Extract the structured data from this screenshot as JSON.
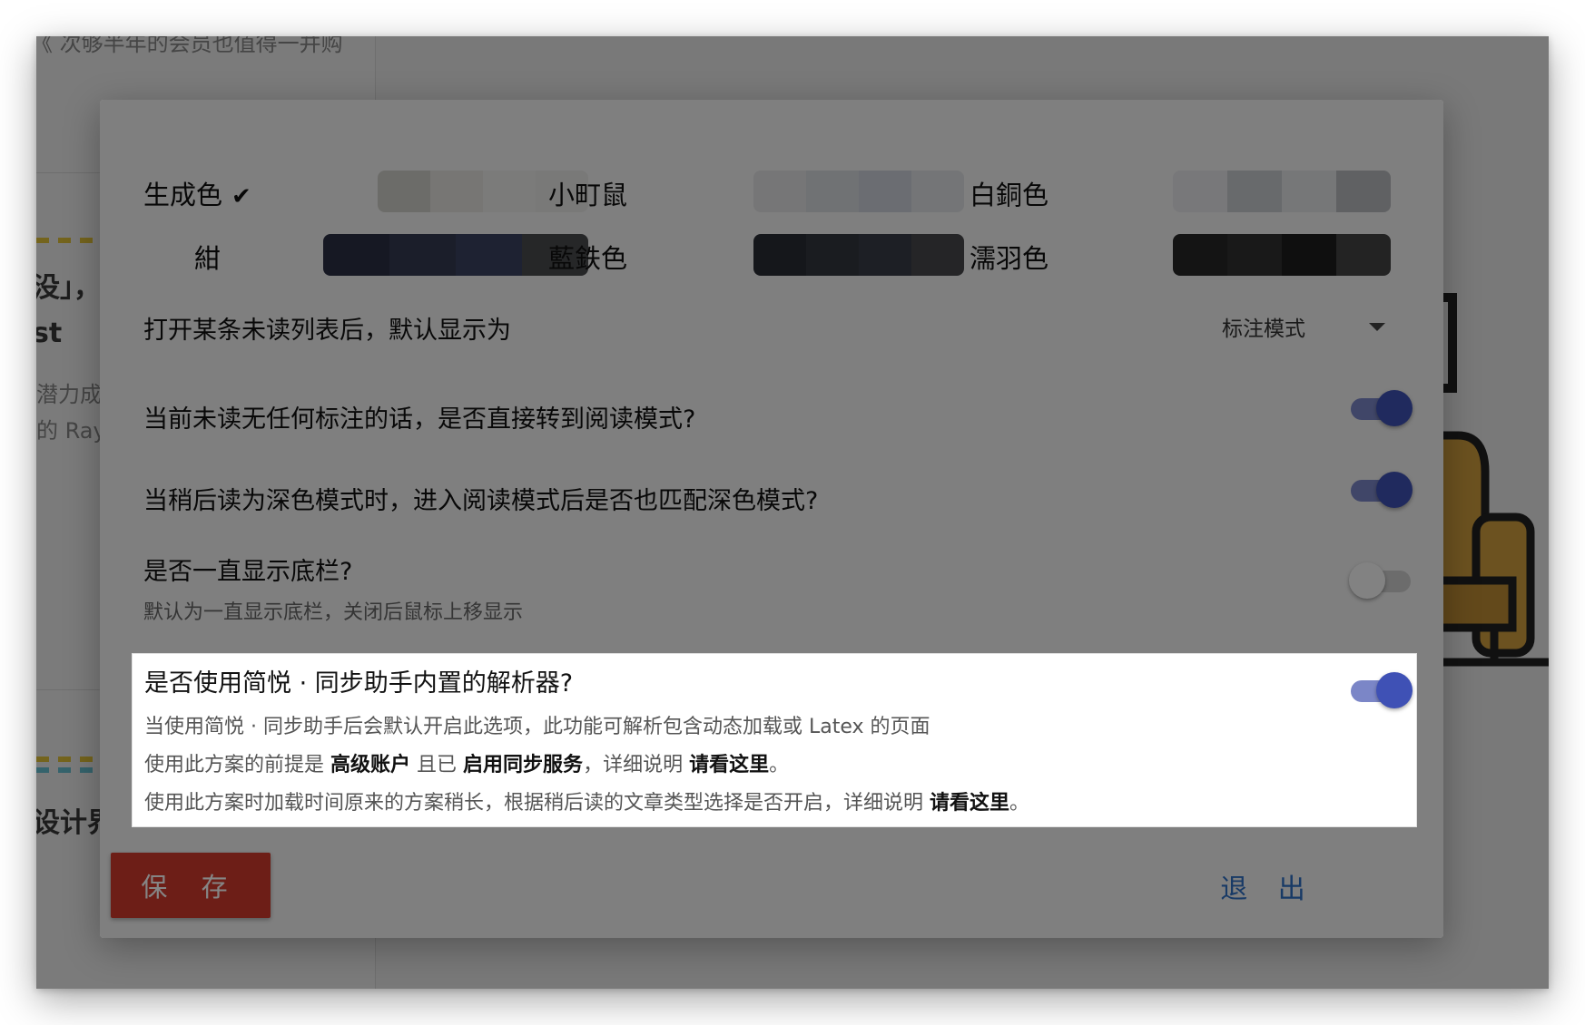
{
  "background": {
    "top_text": "《 次够半年的会员也值得一并购",
    "text_1": "没」，",
    "text_2": "st",
    "text_3": "潜力成",
    "text_4": "的 Ray",
    "text_5": "设计界"
  },
  "colors": {
    "accent": "#3f51b5",
    "save_red": "#d23a2d",
    "link_blue": "#2f6fc4"
  },
  "themes": [
    {
      "label": "生成色",
      "selected": true,
      "check_icon": "checkmark-icon",
      "swatch": [
        "#d0cfc9",
        "#e4e3df",
        "#ececea",
        "#e8e8e6"
      ]
    },
    {
      "label": "小町鼠",
      "selected": false,
      "swatch": [
        "#e2e3e4",
        "#d7dadf",
        "#cdd2da",
        "#dfe1e4"
      ]
    },
    {
      "label": "白銅色",
      "selected": false,
      "swatch": [
        "#e6e7ea",
        "#c8cbcf",
        "#e3e4e7",
        "#b9bbbe"
      ]
    },
    {
      "label": "紺",
      "selected": false,
      "swatch": [
        "#2b2f43",
        "#343a51",
        "#3b4260",
        "#4a4b4e"
      ]
    },
    {
      "label": "藍鉄色",
      "selected": false,
      "swatch": [
        "#2a2d35",
        "#33363f",
        "#383c47",
        "#47484c"
      ]
    },
    {
      "label": "濡羽色",
      "selected": false,
      "swatch": [
        "#282828",
        "#303030",
        "#1e1e1e",
        "#434343"
      ]
    }
  ],
  "settings": {
    "default_view_label": "打开某条未读列表后，默认显示为",
    "default_view_value": "标注模式",
    "auto_read_mode_label": "当前未读无任何标注的话，是否直接转到阅读模式?",
    "auto_read_mode_on": true,
    "dark_match_label": "当稍后读为深色模式时，进入阅读模式后是否也匹配深色模式?",
    "dark_match_on": true,
    "show_footer_label": "是否一直显示底栏?",
    "show_footer_desc": "默认为一直显示底栏，关闭后鼠标上移显示",
    "show_footer_on": false,
    "parser_label": "是否使用简悦 · 同步助手内置的解析器?",
    "parser_on": true,
    "parser_desc_1": "当使用简悦 · 同步助手后会默认开启此选项，此功能可解析包含动态加载或 Latex 的页面",
    "parser_desc_2_a": "使用此方案的前提是",
    "parser_desc_2_b": "高级账户",
    "parser_desc_2_c": "且已",
    "parser_desc_2_d": "启用同步服务",
    "parser_desc_2_e": "，详细说明",
    "parser_desc_2_f": "请看这里",
    "parser_desc_2_g": "。",
    "parser_desc_3_a": "使用此方案时加载时间原来的方案稍长，根据稍后读的文章类型选择是否开启，详细说明",
    "parser_desc_3_b": "请看这里",
    "parser_desc_3_c": "。"
  },
  "buttons": {
    "save": "保 存",
    "exit": "退 出"
  }
}
